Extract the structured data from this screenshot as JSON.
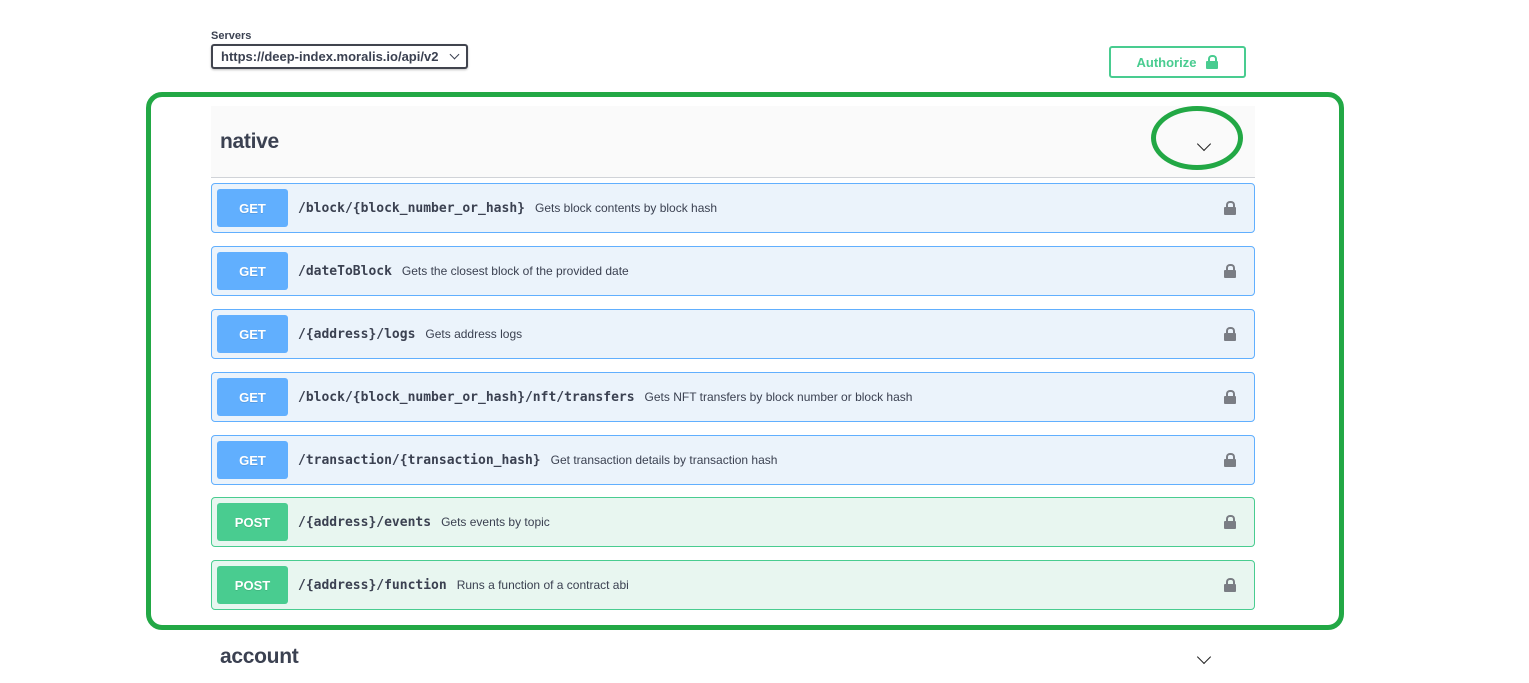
{
  "servers": {
    "label": "Servers",
    "selected": "https://deep-index.moralis.io/api/v2"
  },
  "authorize": {
    "label": "Authorize",
    "icon": "lock-icon"
  },
  "tags": [
    {
      "name": "native",
      "operations": [
        {
          "method": "GET",
          "path": "/block/{block_number_or_hash}",
          "summary": "Gets block contents by block hash"
        },
        {
          "method": "GET",
          "path": "/dateToBlock",
          "summary": "Gets the closest block of the provided date"
        },
        {
          "method": "GET",
          "path": "/{address}/logs",
          "summary": "Gets address logs"
        },
        {
          "method": "GET",
          "path": "/block/{block_number_or_hash}/nft/transfers",
          "summary": "Gets NFT transfers by block number or block hash"
        },
        {
          "method": "GET",
          "path": "/transaction/{transaction_hash}",
          "summary": "Get transaction details by transaction hash"
        },
        {
          "method": "POST",
          "path": "/{address}/events",
          "summary": "Gets events by topic"
        },
        {
          "method": "POST",
          "path": "/{address}/function",
          "summary": "Runs a function of a contract abi"
        }
      ]
    },
    {
      "name": "account"
    }
  ],
  "colors": {
    "get": "#61affe",
    "post": "#49cc90",
    "highlight": "#22a845"
  }
}
